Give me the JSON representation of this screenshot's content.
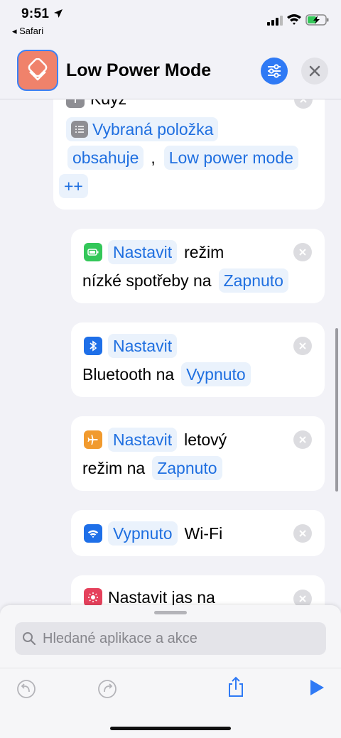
{
  "status_bar": {
    "time": "9:51",
    "back_label": "◂ Safari"
  },
  "header": {
    "title": "Low Power Mode"
  },
  "colors": {
    "accent": "#2f7af5",
    "app_icon": "#f0826b",
    "chip_text": "#1f6fe0",
    "chip_bg": "#eaf2fc"
  },
  "if_block": {
    "keyword": "Když",
    "variable_chip": "Vybraná položka",
    "condition_chip": "obsahuje",
    "comma": ",",
    "value_chip": "Low power mode",
    "extra_chip": "++"
  },
  "actions": [
    {
      "icon": "battery-icon",
      "verb_chip": "Nastavit",
      "text1": "režim",
      "text2": "nízké spotřeby na",
      "value_chip": "Zapnuto"
    },
    {
      "icon": "bluetooth-icon",
      "verb_chip": "Nastavit",
      "text2": "Bluetooth na",
      "value_chip": "Vypnuto"
    },
    {
      "icon": "airplane-icon",
      "verb_chip": "Nastavit",
      "text1": "letový",
      "text2": "režim na",
      "value_chip": "Zapnuto"
    },
    {
      "icon": "wifi-icon",
      "value_chip": "Vypnuto",
      "text1": "Wi-Fi"
    },
    {
      "icon": "brightness-icon",
      "text1": "Nastavit jas na"
    }
  ],
  "search": {
    "placeholder": "Hledané aplikace a akce"
  },
  "toolbar": {
    "undo": "undo-icon",
    "redo": "redo-icon",
    "share": "share-icon",
    "play": "play-icon"
  }
}
